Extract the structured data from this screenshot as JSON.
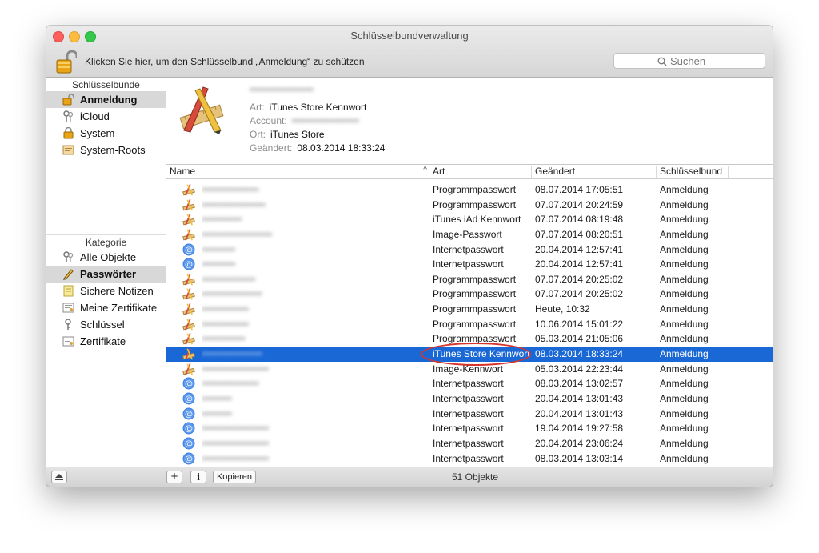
{
  "window": {
    "title": "Schlüsselbundverwaltung"
  },
  "toolbar": {
    "lock_text": "Klicken Sie hier, um den Schlüsselbund „Anmeldung“ zu schützen",
    "search_placeholder": "Suchen"
  },
  "sidebar": {
    "keychains_header": "Schlüsselbunde",
    "keychains": [
      {
        "label": "Anmeldung",
        "icon": "unlocked-keychain-icon",
        "selected": true
      },
      {
        "label": "iCloud",
        "icon": "keys-icon"
      },
      {
        "label": "System",
        "icon": "locked-keychain-icon"
      },
      {
        "label": "System-Roots",
        "icon": "certificate-folder-icon"
      }
    ],
    "category_header": "Kategorie",
    "categories": [
      {
        "label": "Alle Objekte",
        "icon": "keys-icon"
      },
      {
        "label": "Passwörter",
        "icon": "pencil-icon",
        "selected": true
      },
      {
        "label": "Sichere Notizen",
        "icon": "note-icon"
      },
      {
        "label": "Meine Zertifikate",
        "icon": "certificate-icon"
      },
      {
        "label": "Schlüssel",
        "icon": "key-icon"
      },
      {
        "label": "Zertifikate",
        "icon": "certificate-icon"
      }
    ]
  },
  "detail": {
    "name": "•••••••••••••••••••",
    "art_label": "Art:",
    "art_value": "iTunes Store Kennwort",
    "account_label": "Account:",
    "account_value": "••••••••••••••••••••",
    "ort_label": "Ort:",
    "ort_value": "iTunes Store",
    "geaendert_label": "Geändert:",
    "geaendert_value": "08.03.2014 18:33:24"
  },
  "table": {
    "columns": {
      "name": "Name",
      "art": "Art",
      "date": "Geändert",
      "keychain": "Schlüsselbund"
    },
    "rows": [
      {
        "icon": "app-icon",
        "name": "•••••••••••••••••",
        "art": "Programmpasswort",
        "date": "08.07.2014 17:05:51",
        "keychain": "Anmeldung"
      },
      {
        "icon": "app-icon",
        "name": "•••••••••••••••••••",
        "art": "Programmpasswort",
        "date": "07.07.2014 20:24:59",
        "keychain": "Anmeldung"
      },
      {
        "icon": "app-icon",
        "name": "••••••••••••",
        "art": "iTunes iAd Kennwort",
        "date": "07.07.2014 08:19:48",
        "keychain": "Anmeldung"
      },
      {
        "icon": "app-icon",
        "name": "•••••••••••••••••••••",
        "art": "Image-Passwort",
        "date": "07.07.2014 08:20:51",
        "keychain": "Anmeldung"
      },
      {
        "icon": "at-icon",
        "name": "••••••••••",
        "art": "Internetpasswort",
        "date": "20.04.2014 12:57:41",
        "keychain": "Anmeldung"
      },
      {
        "icon": "at-icon",
        "name": "••••••••••",
        "art": "Internetpasswort",
        "date": "20.04.2014 12:57:41",
        "keychain": "Anmeldung"
      },
      {
        "icon": "app-icon",
        "name": "••••••••••••••••",
        "art": "Programmpasswort",
        "date": "07.07.2014 20:25:02",
        "keychain": "Anmeldung"
      },
      {
        "icon": "app-icon",
        "name": "••••••••••••••••••",
        "art": "Programmpasswort",
        "date": "07.07.2014 20:25:02",
        "keychain": "Anmeldung"
      },
      {
        "icon": "app-icon",
        "name": "••••••••••••••",
        "art": "Programmpasswort",
        "date": "Heute, 10:32",
        "keychain": "Anmeldung"
      },
      {
        "icon": "app-icon",
        "name": "••••••••••••••",
        "art": "Programmpasswort",
        "date": "10.06.2014 15:01:22",
        "keychain": "Anmeldung"
      },
      {
        "icon": "app-icon",
        "name": "•••••••••••••",
        "art": "Programmpasswort",
        "date": "05.03.2014 21:05:06",
        "keychain": "Anmeldung"
      },
      {
        "icon": "app-icon",
        "name": "••••••••••••••••••",
        "art": "iTunes Store Kennwort",
        "date": "08.03.2014 18:33:24",
        "keychain": "Anmeldung",
        "selected": true
      },
      {
        "icon": "app-icon",
        "name": "••••••••••••••••••••",
        "art": "Image-Kennwort",
        "date": "05.03.2014 22:23:44",
        "keychain": "Anmeldung"
      },
      {
        "icon": "at-icon",
        "name": "•••••••••••••••••",
        "art": "Internetpasswort",
        "date": "08.03.2014 13:02:57",
        "keychain": "Anmeldung"
      },
      {
        "icon": "at-icon",
        "name": "•••••••••",
        "art": "Internetpasswort",
        "date": "20.04.2014 13:01:43",
        "keychain": "Anmeldung"
      },
      {
        "icon": "at-icon",
        "name": "•••••••••",
        "art": "Internetpasswort",
        "date": "20.04.2014 13:01:43",
        "keychain": "Anmeldung"
      },
      {
        "icon": "at-icon",
        "name": "••••••••••••••••••••",
        "art": "Internetpasswort",
        "date": "19.04.2014 19:27:58",
        "keychain": "Anmeldung"
      },
      {
        "icon": "at-icon",
        "name": "••••••••••••••••••••",
        "art": "Internetpasswort",
        "date": "20.04.2014 23:06:24",
        "keychain": "Anmeldung"
      },
      {
        "icon": "at-icon",
        "name": "••••••••••••••••••••",
        "art": "Internetpasswort",
        "date": "08.03.2014 13:03:14",
        "keychain": "Anmeldung"
      }
    ]
  },
  "footer": {
    "add_label": "+",
    "info_label": "i",
    "copy_label": "Kopieren",
    "count": "51 Objekte"
  },
  "colors": {
    "selection": "#1a68d6",
    "annotation": "#d9342b"
  }
}
